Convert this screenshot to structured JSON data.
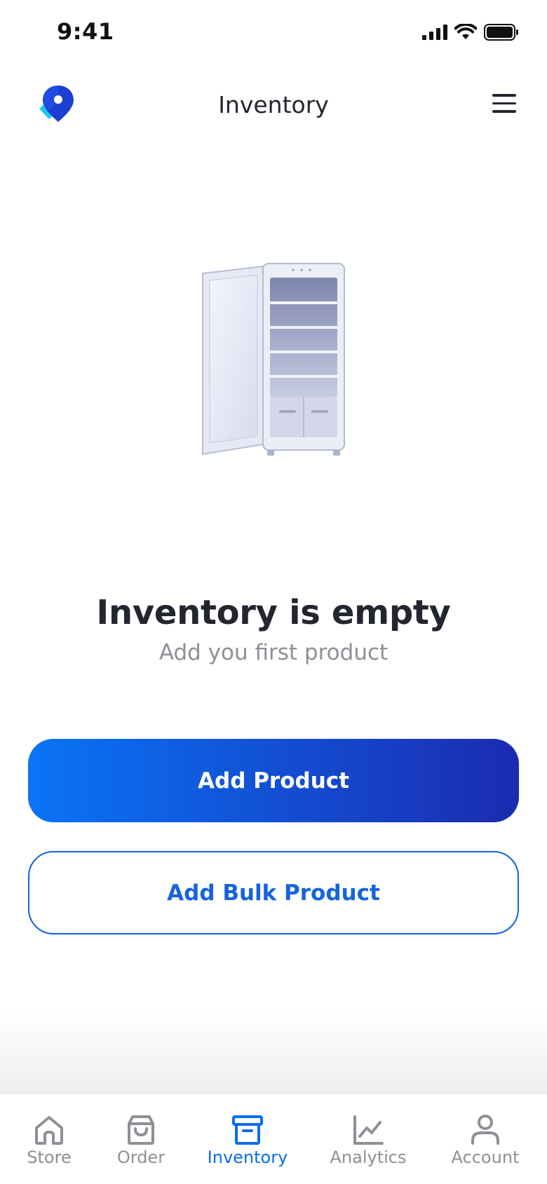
{
  "status_bar": {
    "time": "9:41"
  },
  "header": {
    "title": "Inventory"
  },
  "empty_state": {
    "title": "Inventory is empty",
    "subtitle": "Add you first product"
  },
  "actions": {
    "add_product": "Add Product",
    "add_bulk_product": "Add Bulk Product"
  },
  "tabbar": {
    "items": [
      {
        "label": "Store",
        "icon": "home-icon",
        "active": false
      },
      {
        "label": "Order",
        "icon": "shopping-bag-icon",
        "active": false
      },
      {
        "label": "Inventory",
        "icon": "archive-box-icon",
        "active": true
      },
      {
        "label": "Analytics",
        "icon": "chart-line-icon",
        "active": false
      },
      {
        "label": "Account",
        "icon": "user-icon",
        "active": false
      }
    ]
  },
  "colors": {
    "accent": "#0a6cf0",
    "gradient_start": "#0a74f7",
    "gradient_end": "#1b2bb0",
    "text_primary": "#23262f",
    "text_muted": "#8e9096"
  }
}
